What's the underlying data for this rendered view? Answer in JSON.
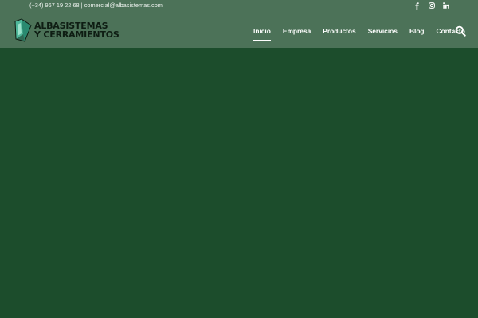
{
  "topbar": {
    "contact": "(+34) 967 19 22 68 | comercial@albasistemas.com",
    "social": [
      "facebook-icon",
      "instagram-icon",
      "linkedin-icon"
    ]
  },
  "logo": {
    "line1": "ALBASISTEMAS",
    "line2": "Y CERRAMIENTOS"
  },
  "nav": {
    "items": [
      {
        "label": "Inicio",
        "active": true
      },
      {
        "label": "Empresa",
        "active": false
      },
      {
        "label": "Productos",
        "active": false
      },
      {
        "label": "Servicios",
        "active": false
      },
      {
        "label": "Blog",
        "active": false
      },
      {
        "label": "Contacto",
        "active": false
      }
    ],
    "search_icon": "search-icon"
  },
  "colors": {
    "header_bg": "#4c7258",
    "page_bg": "#1c4d2c",
    "nav_text": "#ffffff",
    "logo_text": "#0e1d13",
    "logo_mark": "#3fa98a"
  }
}
